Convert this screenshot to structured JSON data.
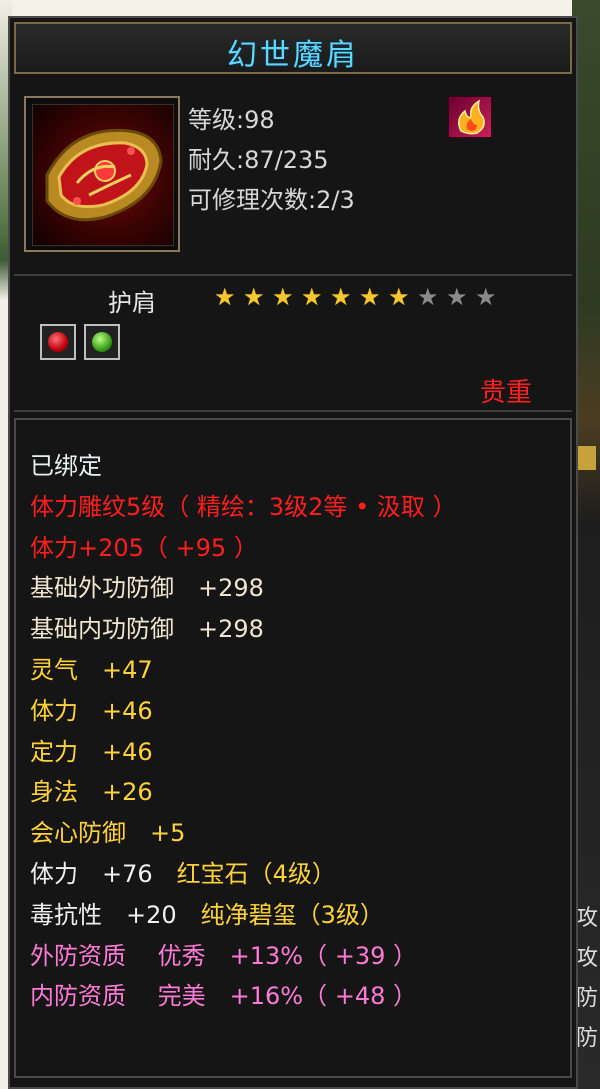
{
  "tooltip": {
    "title": "幻世魔肩",
    "level_text": "等级:98",
    "durability_text": "耐久:87/235",
    "repair_text": "可修理次数:2/3",
    "type_label": "护肩",
    "stars_filled": 7,
    "stars_total": 10,
    "rarity_label": "贵重",
    "badge_icon": "flame-emblem-icon",
    "gems": [
      "red-gem-icon",
      "green-gem-icon"
    ],
    "attributes": [
      {
        "text": "已绑定",
        "color": "#e8f0f0"
      },
      {
        "text": "体力雕纹5级（ 精绘：3级2等 • 汲取 ）",
        "color": "#ff1e1e"
      },
      {
        "text": "体力+205（ +95 ）",
        "color": "#ff1e1e"
      },
      {
        "text": "基础外功防御　+298",
        "color": "#f0e6d0"
      },
      {
        "text": "基础内功防御　+298",
        "color": "#f0e6d0"
      },
      {
        "text": "灵气　+47",
        "color": "#ffd23c"
      },
      {
        "text": "体力　+46",
        "color": "#ffd23c"
      },
      {
        "text": "定力　+46",
        "color": "#ffd23c"
      },
      {
        "text": "身法　+26",
        "color": "#ffd23c"
      },
      {
        "text": "会心防御　+5",
        "color": "#ffd23c"
      },
      {
        "text": "体力　+76　",
        "color": "#f0f0f0",
        "extra": "红宝石（4级）",
        "extra_color": "#ffd23c"
      },
      {
        "text": "毒抗性　+20　",
        "color": "#f0f0f0",
        "extra": "纯净碧玺（3级）",
        "extra_color": "#ffd23c"
      },
      {
        "text": "外防资质　 优秀　+13%（ +39 ）",
        "color": "#ff7ad6"
      },
      {
        "text": "内防资质　 完美　+16%（ +48 ）",
        "color": "#ff7ad6"
      }
    ]
  },
  "background": {
    "right_edge_chars": [
      "攻",
      "攻",
      "防",
      "防"
    ]
  }
}
